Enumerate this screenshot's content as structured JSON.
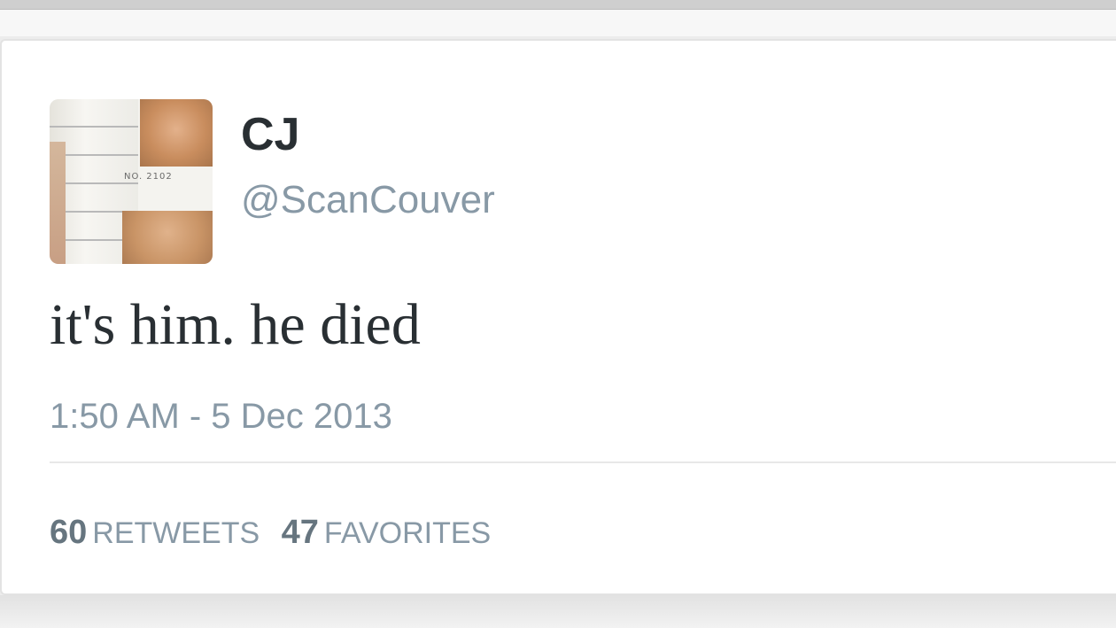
{
  "tweet": {
    "display_name": "CJ",
    "handle": "@ScanCouver",
    "text": "it's him. he died",
    "timestamp": "1:50 AM - 5 Dec 2013",
    "avatar_plate": "NO. 2102"
  },
  "stats": {
    "retweets_count": "60",
    "retweets_label": "RETWEETS",
    "favorites_count": "47",
    "favorites_label": "FAVORITES"
  },
  "colors": {
    "name": "#292f33",
    "secondary": "#8899a6",
    "stat_count": "#66757f",
    "card_bg": "#ffffff"
  },
  "icons": {
    "avatar": "avatar-mugshot-image"
  }
}
